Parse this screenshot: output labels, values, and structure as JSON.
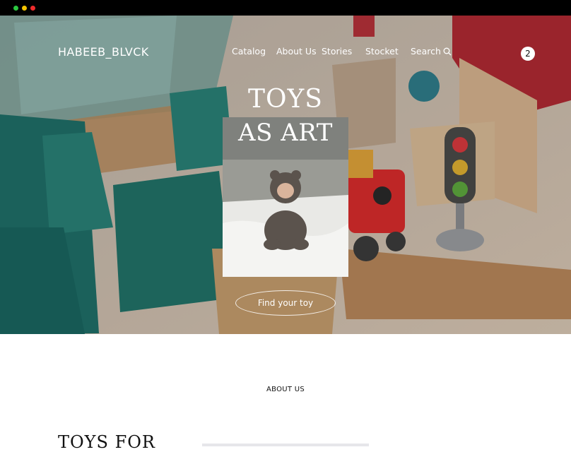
{
  "window": {
    "controls": [
      "green",
      "yellow",
      "red"
    ],
    "colors": {
      "green": "#2bc840",
      "yellow": "#f5c400",
      "red": "#ee2b2b"
    }
  },
  "header": {
    "logo": "HABEEB_BLVCK",
    "nav": [
      {
        "label": "Catalog"
      },
      {
        "label": "About Us"
      },
      {
        "label": "Stories"
      },
      {
        "label": "Stocket"
      },
      {
        "label": "Search"
      }
    ],
    "search_icon": "search-icon",
    "cart_count": "2"
  },
  "hero": {
    "title_line1": "TOYS",
    "title_line2": "AS ART",
    "cta_label": "Find your toy"
  },
  "about": {
    "section_label": "ABOUT US",
    "heading": "TOYS FOR"
  }
}
